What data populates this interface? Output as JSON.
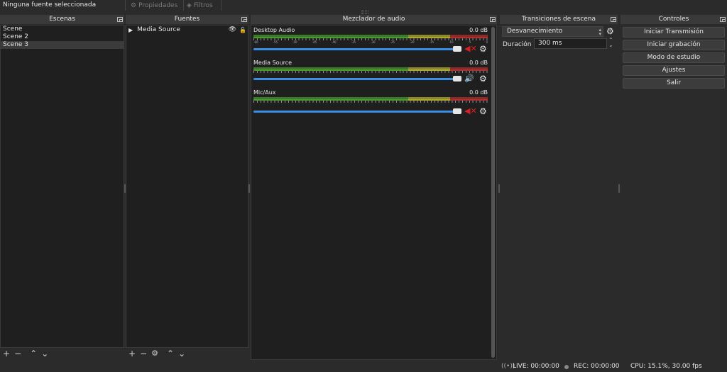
{
  "topbar": {
    "status": "Ninguna fuente seleccionada",
    "properties_label": "Propiedades",
    "filters_label": "Filtros"
  },
  "scenes": {
    "title": "Escenas",
    "items": [
      {
        "label": "Scene"
      },
      {
        "label": "Scene 2"
      },
      {
        "label": "Scene 3"
      }
    ],
    "selected_index": 2
  },
  "sources": {
    "title": "Fuentes",
    "items": [
      {
        "label": "Media Source"
      }
    ]
  },
  "mixer": {
    "title": "Mezclador de audio",
    "scale": [
      "-60",
      "-55",
      "-50",
      "-45",
      "-40",
      "-35",
      "-30",
      "-25",
      "-20",
      "-15",
      "-10",
      "-5",
      "0"
    ],
    "channels": [
      {
        "name": "Desktop Audio",
        "db": "0.0 dB",
        "volume_fraction": 1.0,
        "muted": true
      },
      {
        "name": "Media Source",
        "db": "0.0 dB",
        "volume_fraction": 1.0,
        "muted": false
      },
      {
        "name": "Mic/Aux",
        "db": "0.0 dB",
        "volume_fraction": 1.0,
        "muted": true
      }
    ]
  },
  "transitions": {
    "title": "Transiciones de escena",
    "selected": "Desvanecimiento",
    "duration_label": "Duración",
    "duration_value": "300 ms"
  },
  "controls": {
    "title": "Controles",
    "buttons": [
      {
        "label": "Iniciar Transmisión"
      },
      {
        "label": "Iniciar grabación"
      },
      {
        "label": "Modo de estudio"
      },
      {
        "label": "Ajustes"
      },
      {
        "label": "Salir"
      }
    ]
  },
  "statusbar": {
    "live": "LIVE: 00:00:00",
    "rec": "REC: 00:00:00",
    "cpu": "CPU: 15.1%, 30.00 fps"
  },
  "colors": {
    "meter_green": "#4a9a2f",
    "meter_yellow": "#b0a830",
    "meter_red": "#b02f2f",
    "slider_blue": "#3a8ee6",
    "mute_red": "#d92020"
  }
}
